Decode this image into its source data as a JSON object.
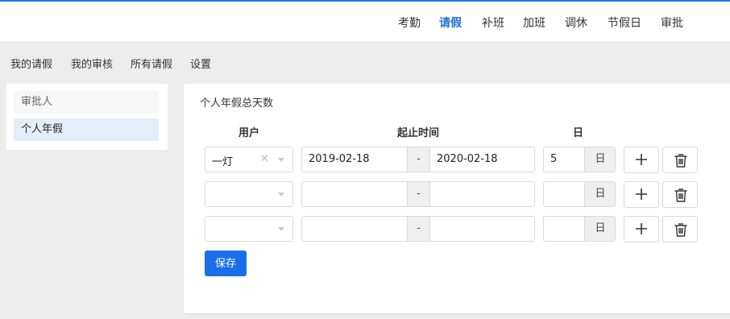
{
  "top_nav": {
    "items": [
      "考勤",
      "请假",
      "补班",
      "加班",
      "调休",
      "节假日",
      "审批"
    ],
    "active": "请假"
  },
  "sub_nav": {
    "items": [
      "我的请假",
      "我的审核",
      "所有请假",
      "设置"
    ]
  },
  "sidebar": {
    "items": [
      "审批人",
      "个人年假"
    ],
    "active": "个人年假"
  },
  "panel": {
    "title": "个人年假总天数",
    "columns": {
      "user": "用户",
      "range": "起止时间",
      "days": "日"
    },
    "rows": [
      {
        "user": "一灯",
        "start": "2019-02-18",
        "end": "2020-02-18",
        "days": "5"
      },
      {
        "user": "",
        "start": "",
        "end": "",
        "days": ""
      },
      {
        "user": "",
        "start": "",
        "end": "",
        "days": ""
      }
    ],
    "range_separator": "-",
    "day_unit": "日",
    "clear_symbol": "✕",
    "save_label": "保存"
  },
  "colors": {
    "accent": "#1a6fe8",
    "active_nav": "#1a6fd6",
    "sidebar_active_bg": "#e3eefb",
    "page_bg": "#ededed"
  },
  "icons": {
    "add": "plus-icon",
    "delete": "trash-icon",
    "dropdown": "chevron-down-icon",
    "clear": "close-icon"
  }
}
